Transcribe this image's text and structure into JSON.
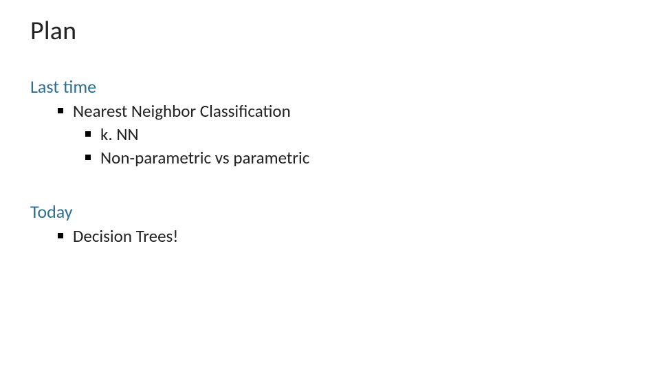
{
  "title": "Plan",
  "sections": [
    {
      "label": "Last time",
      "items": [
        {
          "text": "Nearest Neighbor Classification",
          "sub": [
            {
              "text": "k. NN"
            },
            {
              "text": "Non-parametric vs parametric"
            }
          ]
        }
      ]
    },
    {
      "label": "Today",
      "items": [
        {
          "text": "Decision Trees!",
          "sub": []
        }
      ]
    }
  ]
}
